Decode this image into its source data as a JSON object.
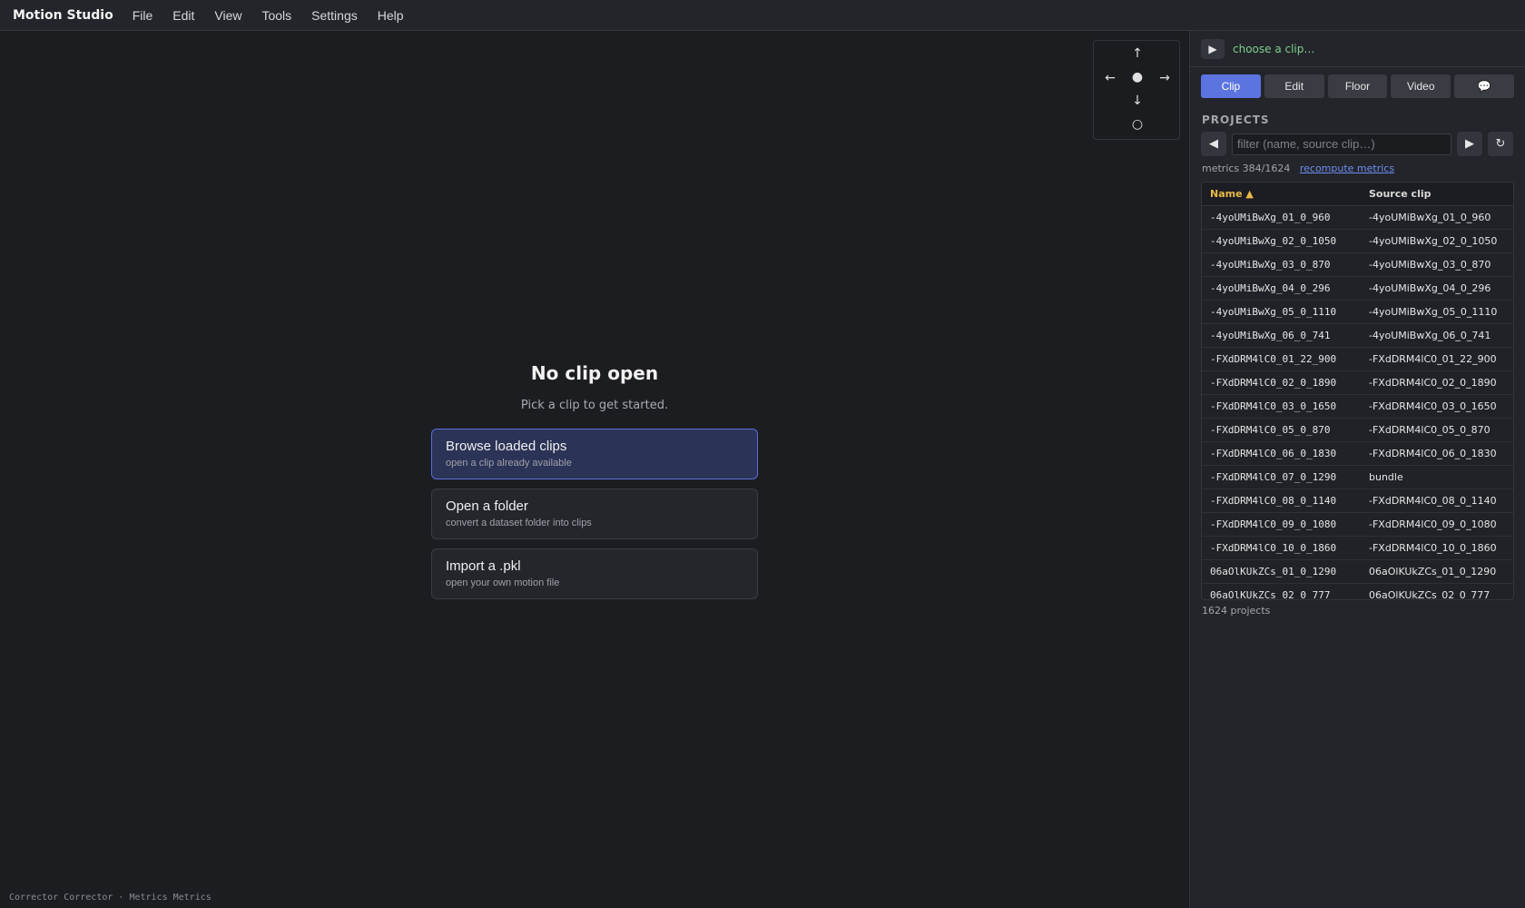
{
  "app": {
    "title": "Motion Studio"
  },
  "menu": [
    "File",
    "Edit",
    "View",
    "Tools",
    "Settings",
    "Help"
  ],
  "dpad": {
    "up": "↑",
    "left": "←",
    "center": "●",
    "right": "→",
    "down": "↓",
    "reset": "○"
  },
  "empty_state": {
    "title": "No clip open",
    "subtitle": "Pick a clip to get started.",
    "options": [
      {
        "title": "Browse loaded clips",
        "subtitle": "open a clip already available"
      },
      {
        "title": "Open a folder",
        "subtitle": "convert a dataset folder into clips"
      },
      {
        "title": "Import a .pkl",
        "subtitle": "open your own motion file"
      }
    ]
  },
  "status": "Corrector Corrector · Metrics Metrics",
  "sidebar": {
    "play_icon": "▶",
    "clip_placeholder": "choose a clip…",
    "tabs": [
      "Clip",
      "Edit",
      "Floor",
      "Video",
      "💬"
    ],
    "section_title": "PROJECTS",
    "prev_icon": "◀",
    "next_icon": "▶",
    "refresh_icon": "↻",
    "filter_placeholder": "filter (name, source clip…)",
    "metrics": "metrics 384/1624",
    "recompute": "recompute metrics",
    "columns": [
      "Name ▲",
      "Source clip"
    ],
    "rows": [
      [
        "-4yoUMiBwXg_01_0_960",
        "-4yoUMiBwXg_01_0_960"
      ],
      [
        "-4yoUMiBwXg_02_0_1050",
        "-4yoUMiBwXg_02_0_1050"
      ],
      [
        "-4yoUMiBwXg_03_0_870",
        "-4yoUMiBwXg_03_0_870"
      ],
      [
        "-4yoUMiBwXg_04_0_296",
        "-4yoUMiBwXg_04_0_296"
      ],
      [
        "-4yoUMiBwXg_05_0_1110",
        "-4yoUMiBwXg_05_0_1110"
      ],
      [
        "-4yoUMiBwXg_06_0_741",
        "-4yoUMiBwXg_06_0_741"
      ],
      [
        "-FXdDRM4lC0_01_22_900",
        "-FXdDRM4lC0_01_22_900"
      ],
      [
        "-FXdDRM4lC0_02_0_1890",
        "-FXdDRM4lC0_02_0_1890"
      ],
      [
        "-FXdDRM4lC0_03_0_1650",
        "-FXdDRM4lC0_03_0_1650"
      ],
      [
        "-FXdDRM4lC0_05_0_870",
        "-FXdDRM4lC0_05_0_870"
      ],
      [
        "-FXdDRM4lC0_06_0_1830",
        "-FXdDRM4lC0_06_0_1830"
      ],
      [
        "-FXdDRM4lC0_07_0_1290",
        "bundle"
      ],
      [
        "-FXdDRM4lC0_08_0_1140",
        "-FXdDRM4lC0_08_0_1140"
      ],
      [
        "-FXdDRM4lC0_09_0_1080",
        "-FXdDRM4lC0_09_0_1080"
      ],
      [
        "-FXdDRM4lC0_10_0_1860",
        "-FXdDRM4lC0_10_0_1860"
      ],
      [
        "06aOlKUkZCs_01_0_1290",
        "06aOlKUkZCs_01_0_1290"
      ],
      [
        "06aOlKUkZCs_02_0_777",
        "06aOlKUkZCs_02_0_777"
      ]
    ],
    "count": "1624 projects"
  }
}
